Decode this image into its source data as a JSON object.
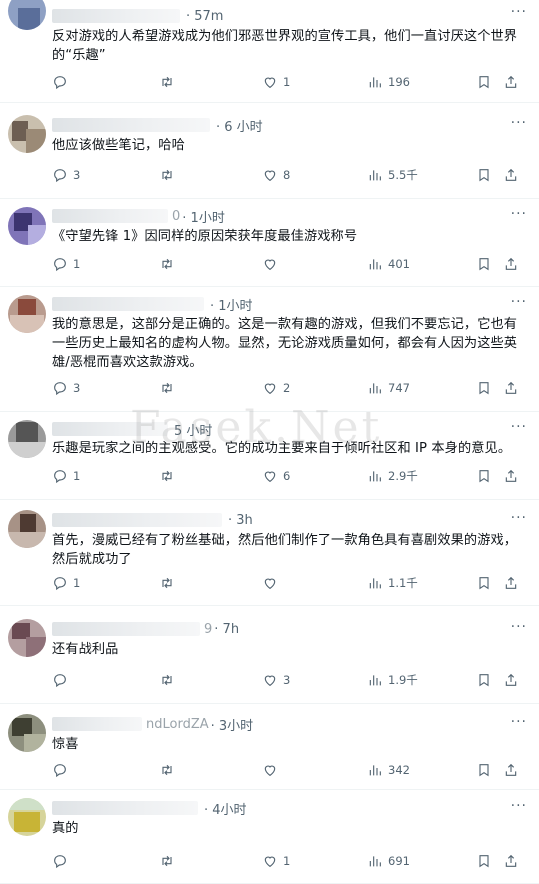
{
  "posts": [
    {
      "time": "· 57m",
      "handle_tail": "",
      "text": "反对游戏的人希望游戏成为他们邪恶世界观的宣传工具，他们一直讨厌这个世界的“乐趣”",
      "reply": "",
      "retweet": "",
      "like": "1",
      "views": "196"
    },
    {
      "time": "· 6 小时",
      "handle_tail": "",
      "text": "他应该做些笔记，哈哈",
      "reply": "3",
      "retweet": "",
      "like": "8",
      "views": "5.5千"
    },
    {
      "time": "· 1小时",
      "handle_tail": "0",
      "text": "《守望先锋 1》因同样的原因荣获年度最佳游戏称号",
      "reply": "1",
      "retweet": "",
      "like": "",
      "views": "401"
    },
    {
      "time": "· 1小时",
      "handle_tail": "",
      "text": "我的意思是，这部分是正确的。这是一款有趣的游戏，但我们不要忘记，它也有一些历史上最知名的虚构人物。显然，无论游戏质量如何，都会有人因为这些英雄/恶棍而喜欢这款游戏。",
      "reply": "3",
      "retweet": "",
      "like": "2",
      "views": "747"
    },
    {
      "time": "5 小时",
      "handle_tail": "",
      "text": "乐趣是玩家之间的主观感受。它的成功主要来自于倾听社区和 IP 本身的意见。",
      "reply": "1",
      "retweet": "",
      "like": "6",
      "views": "2.9千"
    },
    {
      "time": "· 3h",
      "handle_tail": "",
      "text": "首先，漫威已经有了粉丝基础，然后他们制作了一款角色具有喜剧效果的游戏，然后就成功了",
      "reply": "1",
      "retweet": "",
      "like": "",
      "views": "1.1千"
    },
    {
      "time": "· 7h",
      "handle_tail": "9",
      "text": "还有战利品",
      "reply": "",
      "retweet": "",
      "like": "3",
      "views": "1.9千"
    },
    {
      "time": "· 3小时",
      "handle_tail": "ndLordZA",
      "text": "惊喜",
      "reply": "",
      "retweet": "",
      "like": "",
      "views": "342"
    },
    {
      "time": "· 4小时",
      "handle_tail": "",
      "text": "真的",
      "reply": "",
      "retweet": "",
      "like": "1",
      "views": "691"
    }
  ],
  "more_label": "···",
  "watermark": "Fasek.Net",
  "colors": {
    "text": "#0f1419",
    "muted": "#536471",
    "divider": "#eff3f4"
  },
  "icons": [
    "reply-icon",
    "retweet-icon",
    "like-icon",
    "views-icon",
    "bookmark-icon",
    "share-icon",
    "more-icon"
  ]
}
